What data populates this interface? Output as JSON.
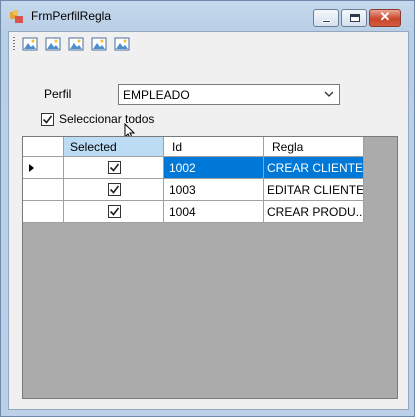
{
  "window": {
    "title": "FrmPerfilRegla",
    "close_glyph": "✕",
    "controls": [
      "minimize-icon",
      "maximize-icon",
      "close-icon"
    ]
  },
  "toolbar": {
    "icons": [
      "image-icon",
      "image-icon",
      "image-icon",
      "image-icon",
      "image-icon"
    ]
  },
  "form": {
    "perfil_label": "Perfil",
    "perfil_value": "EMPLEADO",
    "select_all_label": "Seleccionar todos",
    "select_all_checked": true
  },
  "grid": {
    "columns": [
      "Selected",
      "Id",
      "Regla"
    ],
    "rows": [
      {
        "selected": true,
        "id": "1002",
        "regla": "CREAR CLIENTE"
      },
      {
        "selected": true,
        "id": "1003",
        "regla": "EDITAR CLIENTE"
      },
      {
        "selected": true,
        "id": "1004",
        "regla": "CREAR PRODU..."
      }
    ],
    "current_row": 0
  },
  "colors": {
    "selection": "#0078d7",
    "header_selected": "#bcdcf4",
    "grid_background": "#ababab"
  }
}
